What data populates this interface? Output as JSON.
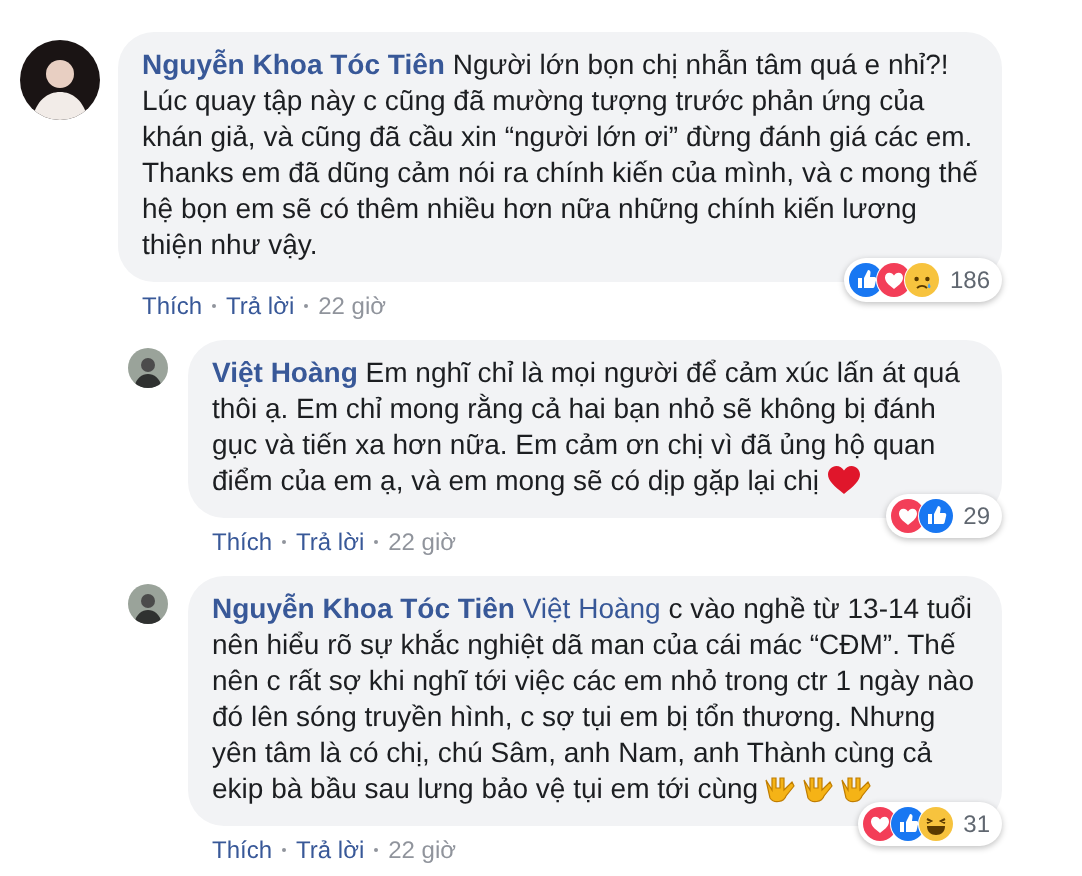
{
  "comments": [
    {
      "author": "Nguyễn Khoa Tóc Tiên",
      "text": "Người lớn bọn chị nhẫn tâm quá e nhỉ?! Lúc quay tập này c cũng đã mường tượng trước phản ứng của khán giả, và cũng đã cầu xin “người lớn ơi” đừng đánh giá các em. Thanks em đã dũng cảm nói ra chính kiến của mình, và c mong thế hệ bọn em sẽ có thêm nhiều hơn nữa những chính kiến lương thiện như vậy.",
      "actions": [
        "Thích",
        "Trả lời"
      ],
      "time": "22 giờ",
      "reactions": [
        {
          "kind": "like"
        },
        {
          "kind": "love"
        },
        {
          "kind": "sad"
        }
      ],
      "reaction_count": "186",
      "children": [
        {
          "author": "Việt Hoàng",
          "text": "Em nghĩ chỉ là mọi người để cảm xúc lấn át quá thôi ạ. Em chỉ mong rằng cả hai bạn nhỏ sẽ không bị đánh gục và tiến xa hơn nữa. Em cảm ơn chị vì đã ủng hộ quan điểm của em ạ, và em mong sẽ có dịp gặp lại chị",
          "emojis": [
            {
              "kind": "heart"
            }
          ],
          "actions": [
            "Thích",
            "Trả lời"
          ],
          "time": "22 giờ",
          "reactions": [
            {
              "kind": "love"
            },
            {
              "kind": "like"
            }
          ],
          "reaction_count": "29"
        },
        {
          "author": "Nguyễn Khoa Tóc Tiên",
          "reply_to": "Việt Hoàng",
          "text": "c vào nghề từ 13-14 tuổi nên hiểu rõ sự khắc nghiệt dã man của cái mác “CĐM”. Thế nên c rất sợ khi nghĩ tới việc các em nhỏ trong ctr 1 ngày nào đó lên sóng truyền hình, c sợ tụi em bị tổn thương. Nhưng yên tâm là có chị, chú Sâm, anh Nam, anh Thành cùng cả ekip bà bầu sau lưng bảo vệ tụi em tới cùng",
          "emojis": [
            {
              "kind": "rock-hand"
            },
            {
              "kind": "rock-hand"
            },
            {
              "kind": "rock-hand"
            }
          ],
          "actions": [
            "Thích",
            "Trả lời"
          ],
          "time": "22 giờ",
          "reactions": [
            {
              "kind": "love"
            },
            {
              "kind": "like"
            },
            {
              "kind": "haha"
            }
          ],
          "reaction_count": "31"
        }
      ]
    }
  ]
}
